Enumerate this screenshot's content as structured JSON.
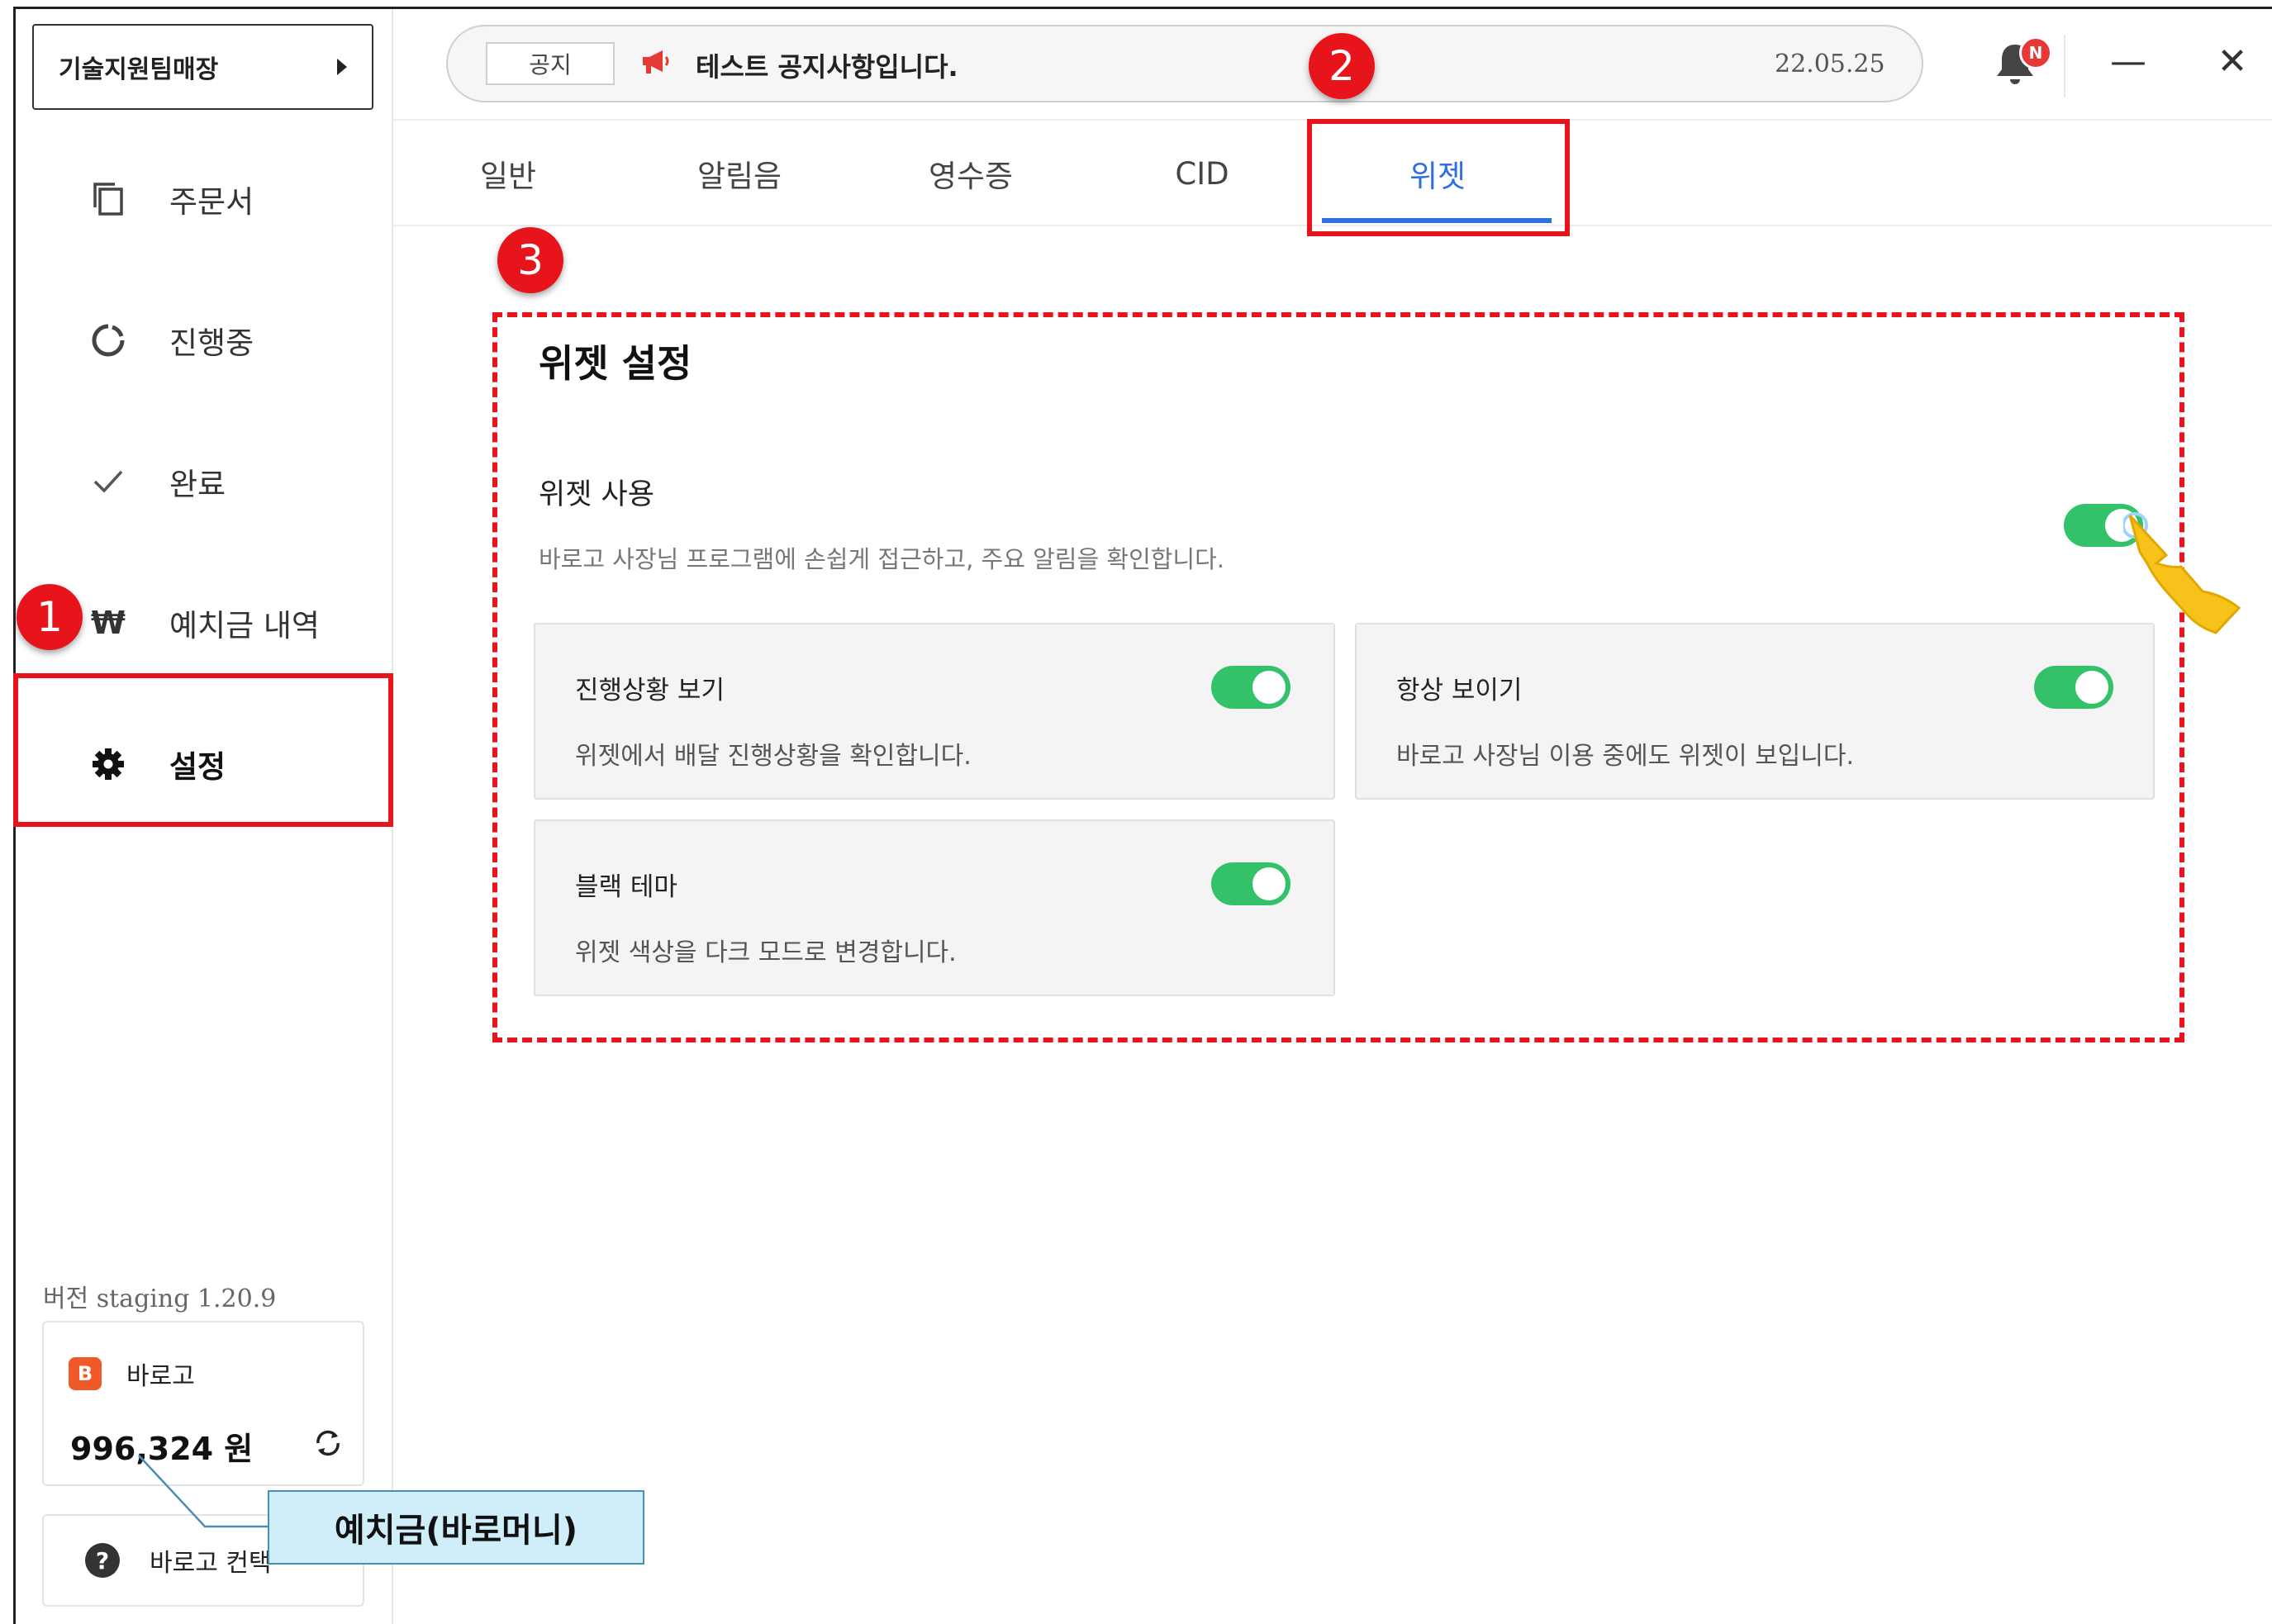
{
  "sidebar": {
    "store_name": "기술지원팀매장",
    "items": [
      {
        "label": "주문서",
        "icon": "copy-icon"
      },
      {
        "label": "진행중",
        "icon": "progress-ring-icon"
      },
      {
        "label": "완료",
        "icon": "check-icon"
      },
      {
        "label": "예치금 내역",
        "icon": "won-icon"
      },
      {
        "label": "설정",
        "icon": "gear-icon"
      }
    ],
    "active_item": "설정",
    "version": "버전 staging 1.20.9",
    "balance": {
      "brand_logo": "B",
      "brand_name": "바로고",
      "amount": "996,324 원"
    },
    "contact_label": "바로고 컨택"
  },
  "notice": {
    "tag": "공지",
    "text": "테스트 공지사항입니다.",
    "date": "22.05.25"
  },
  "header": {
    "bell_badge": "N",
    "minimize_glyph": "—",
    "close_glyph": "✕"
  },
  "tabs": [
    "일반",
    "알림음",
    "영수증",
    "CID",
    "위젯"
  ],
  "active_tab": "위젯",
  "widget_settings": {
    "title": "위젯 설정",
    "use_label": "위젯 사용",
    "use_desc": "바로고 사장님 프로그램에 손쉽게 접근하고, 주요 알림을 확인합니다.",
    "use_enabled": true,
    "options": [
      {
        "title": "진행상황 보기",
        "desc": "위젯에서 배달 진행상황을 확인합니다.",
        "enabled": true
      },
      {
        "title": "항상 보이기",
        "desc": "바로고 사장님 이용 중에도 위젯이 보입니다.",
        "enabled": true
      },
      {
        "title": "블랙 테마",
        "desc": "위젯 색상을 다크 모드로 변경합니다.",
        "enabled": true
      }
    ]
  },
  "annotations": {
    "steps": [
      "1",
      "2",
      "3"
    ],
    "callout": "예치금(바로머니)"
  },
  "colors": {
    "accent_blue": "#2f6fe0",
    "toggle_on": "#33c26a",
    "annotation_red": "#e8141c",
    "brand_orange": "#f05a28"
  }
}
